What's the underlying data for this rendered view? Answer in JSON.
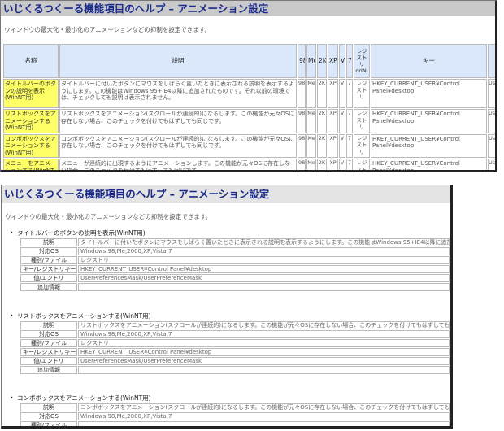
{
  "panel1": {
    "title": "いじくるつくーる機能項目のヘルプ – アニメーション設定",
    "description": "ウィンドウの最大化・最小化のアニメーションなどの抑制を設定できます。",
    "headers": {
      "name": "名称",
      "explanation": "説明",
      "os98": "98",
      "osMe": "Me",
      "os2K": "2K",
      "osXP": "XP",
      "osV": "V",
      "os7": "7",
      "registry": "レジストリorINI",
      "key": "キー"
    },
    "rows": [
      {
        "name": "タイトルバーのボタンの説明を表示(WinNT用)",
        "explanation": "タイトルバーに付いたボタンにマウスをしばらく置いたときに表示される説明を表示するようにします。この機能はWindows 95+IE4以降に追加されたものです。それ以前の環境では、チェックしても説明は表示されません。",
        "os98": "98",
        "osMe": "Me",
        "os2K": "2K",
        "osXP": "XP",
        "osV": "V",
        "os7": "7",
        "registry": "レジストリ",
        "key": "HKEY_CURRENT_USER¥Control Panel¥desktop",
        "value": "Use"
      },
      {
        "name": "リストボックスをアニメーションする(WinNT用)",
        "explanation": "リストボックスをアニメーション(スクロールが連続的)になるします。この機能が元々OSに存在しない場合、このチェックを付けてもはずしても同じです。",
        "os98": "98",
        "osMe": "Me",
        "os2K": "2K",
        "osXP": "XP",
        "osV": "V",
        "os7": "7",
        "registry": "レジストリ",
        "key": "HKEY_CURRENT_USER¥Control Panel¥desktop",
        "value": "Use"
      },
      {
        "name": "コンボボックスをアニメーションする(WinNT用)",
        "explanation": "コンボボックスをアニメーション(スクロールが連続的)になるします。この機能が元々OSに存在しない場合、このチェックを付けてもはずしても同じです。",
        "os98": "98",
        "osMe": "Me",
        "os2K": "2K",
        "osXP": "XP",
        "osV": "V",
        "os7": "7",
        "registry": "レジストリ",
        "key": "HKEY_CURRENT_USER¥Control Panel¥desktop",
        "value": "Use"
      },
      {
        "name": "メニューをアニメーションする(WinNT用)",
        "explanation": "メニューが連続的に出現するようにアニメーションします。この機能が元々OSに存在しない場合、このチェックを付けてもはずしても同じです。",
        "os98": "98",
        "osMe": "Me",
        "os2K": "2K",
        "osXP": "XP",
        "osV": "V",
        "os7": "7",
        "registry": "レジストリ",
        "key": "HKEY_CURRENT_USER¥Control Panel¥desktop",
        "value": "Use"
      }
    ]
  },
  "panel2": {
    "title": "いじくるつくーる機能項目のヘルプ – アニメーション設定",
    "description": "ウィンドウの最大化・最小化のアニメーションなどの抑制を設定できます。",
    "labels": {
      "explanation": "説明",
      "os": "対応OS",
      "type": "種別/ファイル",
      "key": "キー/レジストリキー",
      "value": "値/エントリ",
      "extra": "追加情報"
    },
    "entries": [
      {
        "bullet": "•",
        "title": "タイトルバーのボタンの説明を表示(WinNT用)",
        "explanation": "タイトルバーに付いたボタンにマウスをしばらく置いたときに表示される説明を表示するようにします。この機能はWindows 95+IE4以降に追加されたものです。",
        "os": "Windows 98,Me,2000,XP,Vista,7",
        "type": "レジストリ",
        "key": "HKEY_CURRENT_USER¥Control Panel¥desktop",
        "value": "UserPreferencesMask/UserPreferenceMask",
        "extra": ""
      },
      {
        "bullet": "•",
        "title": "リストボックスをアニメーションする(WinNT用)",
        "explanation": "リストボックスをアニメーション(スクロールが連続的)になるします。この機能が元々OSに存在しない場合、このチェックを付けてもはずしても同じです。",
        "os": "Windows 98,Me,2000,XP,Vista,7",
        "type": "レジストリ",
        "key": "HKEY_CURRENT_USER¥Control Panel¥desktop",
        "value": "UserPreferencesMask/UserPreferenceMask",
        "extra": ""
      },
      {
        "bullet": "•",
        "title": "コンボボックスをアニメーションする(WinNT用)",
        "explanation": "コンボボックスをアニメーション(スクロールが連続的)になるします。この機能が元々OSに存在しない場合、このチェックを付けてもはずしても同じです。",
        "os": "Windows 98,Me,2000,XP,Vista,7",
        "type": "",
        "key": "",
        "value": "",
        "extra": ""
      }
    ]
  },
  "colors": {
    "title_text": "#1a2a8a",
    "header_bg": "#dbe8fb",
    "name_bg": "#ffff66"
  }
}
